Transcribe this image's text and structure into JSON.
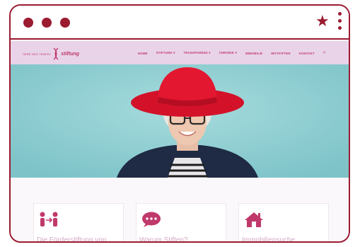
{
  "browser": {
    "window_dots": [
      "dot",
      "dot",
      "dot"
    ],
    "bookmark_icon": "star-icon",
    "menu_icon": "kebab-menu-icon",
    "accent_color": "#9b1b30"
  },
  "site": {
    "logo": {
      "small_text": "TIERE DES TEMPEL",
      "brand": "stiftung",
      "color": "#c0396b"
    },
    "nav": {
      "items": [
        {
          "label": "HOME"
        },
        {
          "label": "STIFTUNG ▾"
        },
        {
          "label": "TRANSPARENZ ▾"
        },
        {
          "label": "CHRONIK ▾"
        },
        {
          "label": "IMMOBILIE"
        },
        {
          "label": "MITSTIFTEN"
        },
        {
          "label": "KONTAKT"
        }
      ],
      "search_icon": "search-icon",
      "background": "#e9d3e9"
    },
    "hero": {
      "background": "#8fcfd3",
      "subject": "smiling woman in red hat and glasses"
    },
    "cards": [
      {
        "icon": "people-exchange-icon",
        "title": "Die Förderstiftung von"
      },
      {
        "icon": "speech-bubble-icon",
        "title": "Warum Stiften?"
      },
      {
        "icon": "house-icon",
        "title": "Immobiliensuche"
      }
    ],
    "card_text_color": "#d4a7c7"
  }
}
